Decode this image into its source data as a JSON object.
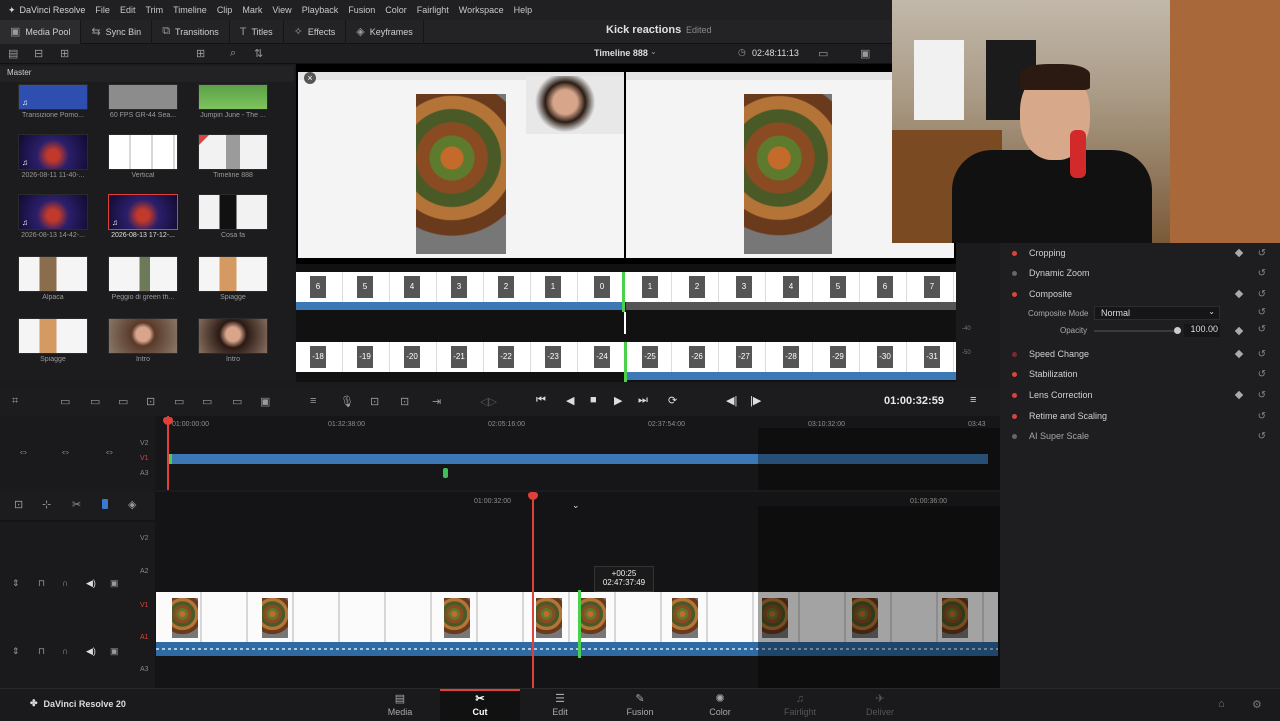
{
  "menubar": {
    "app": "DaVinci Resolve",
    "items": [
      "File",
      "Edit",
      "Trim",
      "Timeline",
      "Clip",
      "Mark",
      "View",
      "Playback",
      "Fusion",
      "Color",
      "Fairlight",
      "Workspace",
      "Help"
    ]
  },
  "toolbar": {
    "media_pool": "Media Pool",
    "sync_bin": "Sync Bin",
    "transitions": "Transitions",
    "titles": "Titles",
    "effects": "Effects",
    "keyframes": "Keyframes"
  },
  "project": {
    "title": "Kick reactions",
    "status": "Edited"
  },
  "viewer": {
    "timeline_name": "Timeline 888",
    "timecode": "02:48:11:13"
  },
  "media_pool": {
    "bin": "Master",
    "clips": [
      {
        "name": "Transizione Pomo..."
      },
      {
        "name": "60 FPS GR-44 Sea..."
      },
      {
        "name": "Jumpin June - The ..."
      },
      {
        "name": "2026-08-11 11-40-..."
      },
      {
        "name": "Vertical"
      },
      {
        "name": "Timeline 888"
      },
      {
        "name": "2026-08-13 14-42-..."
      },
      {
        "name": "2026-08-13 17-12-..."
      },
      {
        "name": "Cosa fa"
      },
      {
        "name": "Alpaca"
      },
      {
        "name": "Peggio di green th..."
      },
      {
        "name": "Spiagge"
      },
      {
        "name": "Spiagge"
      },
      {
        "name": "Intro"
      },
      {
        "name": "Intro"
      }
    ]
  },
  "trackbar": {
    "top_frames": [
      "6",
      "5",
      "4",
      "3",
      "2",
      "1",
      "0",
      "1",
      "2",
      "3",
      "4",
      "5",
      "6",
      "7"
    ],
    "bottom_frames": [
      "-18",
      "-19",
      "-20",
      "-21",
      "-22",
      "-23",
      "-24",
      "-25",
      "-26",
      "-27",
      "-28",
      "-29",
      "-30",
      "-31"
    ],
    "meter": [
      "-40",
      "-50"
    ]
  },
  "transport": {
    "timecode": "01:00:32:59"
  },
  "upper_timeline": {
    "ruler": [
      "01:00:00:00",
      "01:32:38:00",
      "02:05:16:00",
      "02:37:54:00",
      "03:10:32:00",
      "03:43"
    ],
    "tracks": [
      "V2",
      "V1",
      "A3"
    ]
  },
  "lower_timeline": {
    "ruler": [
      "01:00:32:00",
      "01:00:36:00"
    ],
    "tracks": [
      "V2",
      "A2",
      "V1",
      "A1",
      "A3"
    ],
    "tooltip_offset": "+00:25",
    "tooltip_tc": "02:47:37:49"
  },
  "inspector": {
    "rows": [
      {
        "label": "Cropping",
        "on": true
      },
      {
        "label": "Dynamic Zoom",
        "on": false
      },
      {
        "label": "Composite",
        "on": true
      },
      {
        "label": "Speed Change",
        "on": true
      },
      {
        "label": "Stabilization",
        "on": true
      },
      {
        "label": "Lens Correction",
        "on": true
      },
      {
        "label": "Retime and Scaling",
        "on": true
      },
      {
        "label": "AI Super Scale",
        "on": false
      }
    ],
    "composite_mode_label": "Composite Mode",
    "composite_mode_value": "Normal",
    "opacity_label": "Opacity",
    "opacity_value": "100.00"
  },
  "pages": {
    "brand": "DaVinci Resolve 20",
    "items": [
      "Media",
      "Cut",
      "Edit",
      "Fusion",
      "Color",
      "Fairlight",
      "Deliver"
    ]
  },
  "colors": {
    "accent": "#e0403a",
    "clip_blue": "#3b78b5",
    "bg": "#1b1b1d"
  }
}
